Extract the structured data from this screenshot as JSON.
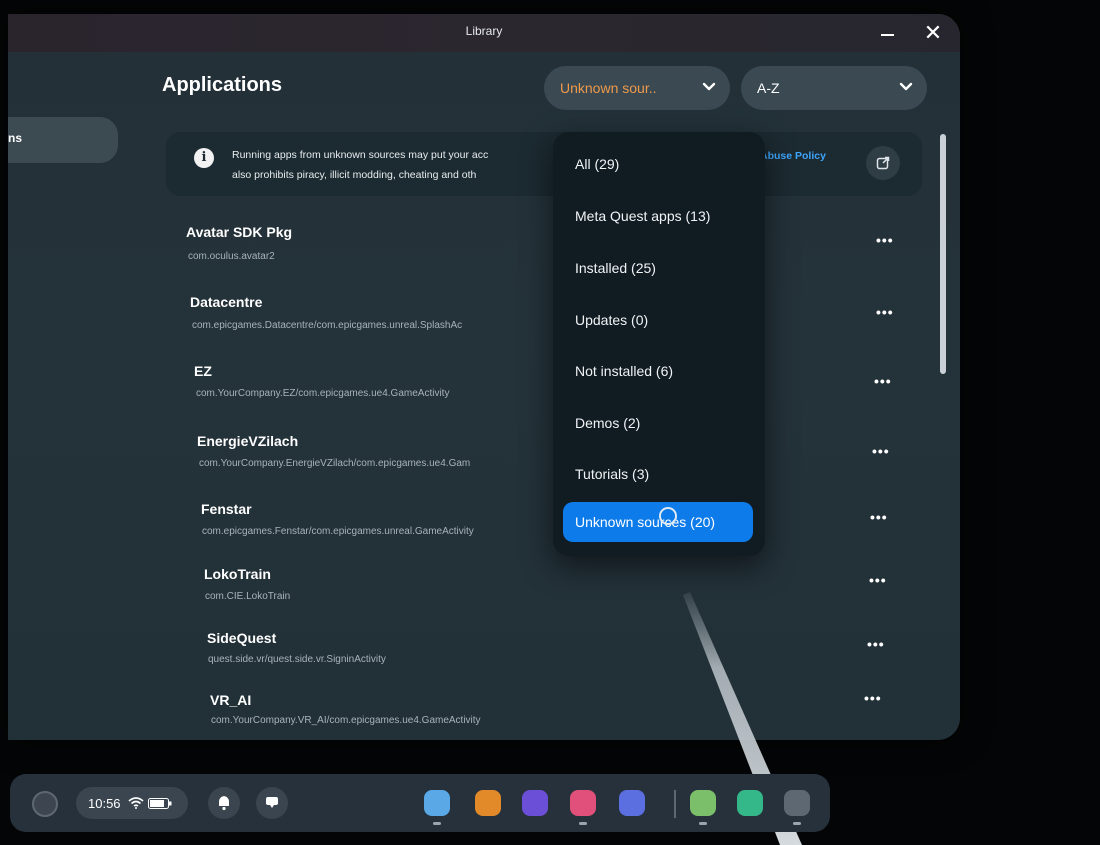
{
  "window": {
    "title": "Library",
    "minimize_label": "",
    "close_label": "✕"
  },
  "sidebar": {
    "items": [
      {
        "label": "ns"
      }
    ]
  },
  "main": {
    "heading": "Applications",
    "source_filter": {
      "selected": "Unknown sour..",
      "color": "#ee9a4b"
    },
    "sort_filter": {
      "selected": "A-Z"
    }
  },
  "notice": {
    "line1": "Running apps from unknown sources may put your acc",
    "line2": "also prohibits piracy, illicit modding, cheating and oth",
    "link": "Abuse Policy",
    "link_color": "#3ea6ff",
    "icon": "info-icon",
    "action_icon": "external-link-icon"
  },
  "apps": [
    {
      "name": "Avatar SDK Pkg",
      "package": "com.oculus.avatar2",
      "more": "•••"
    },
    {
      "name": "Datacentre",
      "package": "com.epicgames.Datacentre/com.epicgames.unreal.SplashAc",
      "more": "•••"
    },
    {
      "name": "EZ",
      "package": "com.YourCompany.EZ/com.epicgames.ue4.GameActivity",
      "more": "•••"
    },
    {
      "name": "EnergieVZilach",
      "package": "com.YourCompany.EnergieVZilach/com.epicgames.ue4.Gam",
      "more": "•••"
    },
    {
      "name": "Fenstar",
      "package": "com.epicgames.Fenstar/com.epicgames.unreal.GameActivity",
      "more": "•••"
    },
    {
      "name": "LokoTrain",
      "package": "com.CIE.LokoTrain",
      "more": "•••"
    },
    {
      "name": "SideQuest",
      "package": "quest.side.vr/quest.side.vr.SigninActivity",
      "more": "•••"
    },
    {
      "name": "VR_AI",
      "package": "com.YourCompany.VR_AI/com.epicgames.ue4.GameActivity",
      "more": "•••"
    }
  ],
  "filter_menu": {
    "items": [
      {
        "label": "All (29)"
      },
      {
        "label": "Meta Quest apps (13)"
      },
      {
        "label": "Installed (25)"
      },
      {
        "label": "Updates (0)"
      },
      {
        "label": "Not installed (6)"
      },
      {
        "label": "Demos (2)"
      },
      {
        "label": "Tutorials (3)"
      },
      {
        "label": "Unknown sources (20)",
        "selected": true
      }
    ],
    "selected_color": "#0d7be9"
  },
  "taskbar": {
    "time": "10:56",
    "status_icons": [
      "wifi-icon",
      "battery-icon"
    ],
    "quick_buttons": [
      "bell-icon",
      "chat-icon"
    ],
    "apps": [
      {
        "icon": "store-icon",
        "color": "#5aa9e6"
      },
      {
        "icon": "bag-icon",
        "color": "#e28a2a"
      },
      {
        "icon": "people-icon",
        "color": "#6b4fd6"
      },
      {
        "icon": "camera-icon",
        "color": "#e0507a"
      },
      {
        "icon": "browser-icon",
        "color": "#5b6fe0"
      },
      {
        "icon": "window-icon",
        "color": "#7bbf6a"
      },
      {
        "icon": "settings-icon",
        "color": "#34b88a"
      },
      {
        "icon": "grid-icon",
        "color": "#5d6873"
      }
    ]
  }
}
